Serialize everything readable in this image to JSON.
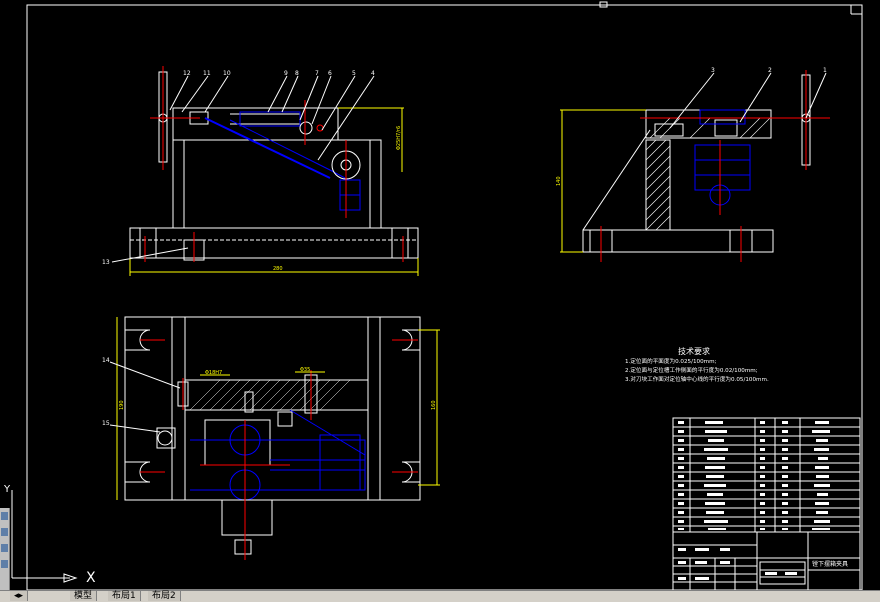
{
  "drawing": {
    "title_block_name": "镗下摆箱夹具",
    "tech_requirements": {
      "heading": "技术要求",
      "items": [
        "1.定位面的平面度为0.025/100mm;",
        "2.定位面与定位槽工作侧面的平行度为0.02/100mm;",
        "3.对刀块工作面对定位轴中心线的平行度为0.05/100mm."
      ]
    },
    "part_numbers_main": [
      "12",
      "11",
      "10",
      "9",
      "8",
      "7",
      "6",
      "5",
      "4"
    ],
    "part_numbers_side": [
      "3",
      "2",
      "1"
    ],
    "part_numbers_left": [
      "13",
      "14",
      "15"
    ],
    "dimension_labels": {
      "width_front": "280",
      "height_side": "140",
      "height_bottom": "190",
      "height_right": "160",
      "dim_tag_1": "Φ25H7/r6",
      "dim_tag_2": "Φ18H7",
      "dim_tag_3": "Φ35"
    },
    "axis": {
      "x_label": "X",
      "y_label": "Y"
    }
  },
  "tabs": [
    "模型",
    "布局1",
    "布局2"
  ],
  "colors": {
    "background": "#000000",
    "outline": "#ffffff",
    "blue": "#0000ff",
    "red": "#ff0000",
    "yellow": "#ffff00",
    "hatch": "#ffffff"
  }
}
